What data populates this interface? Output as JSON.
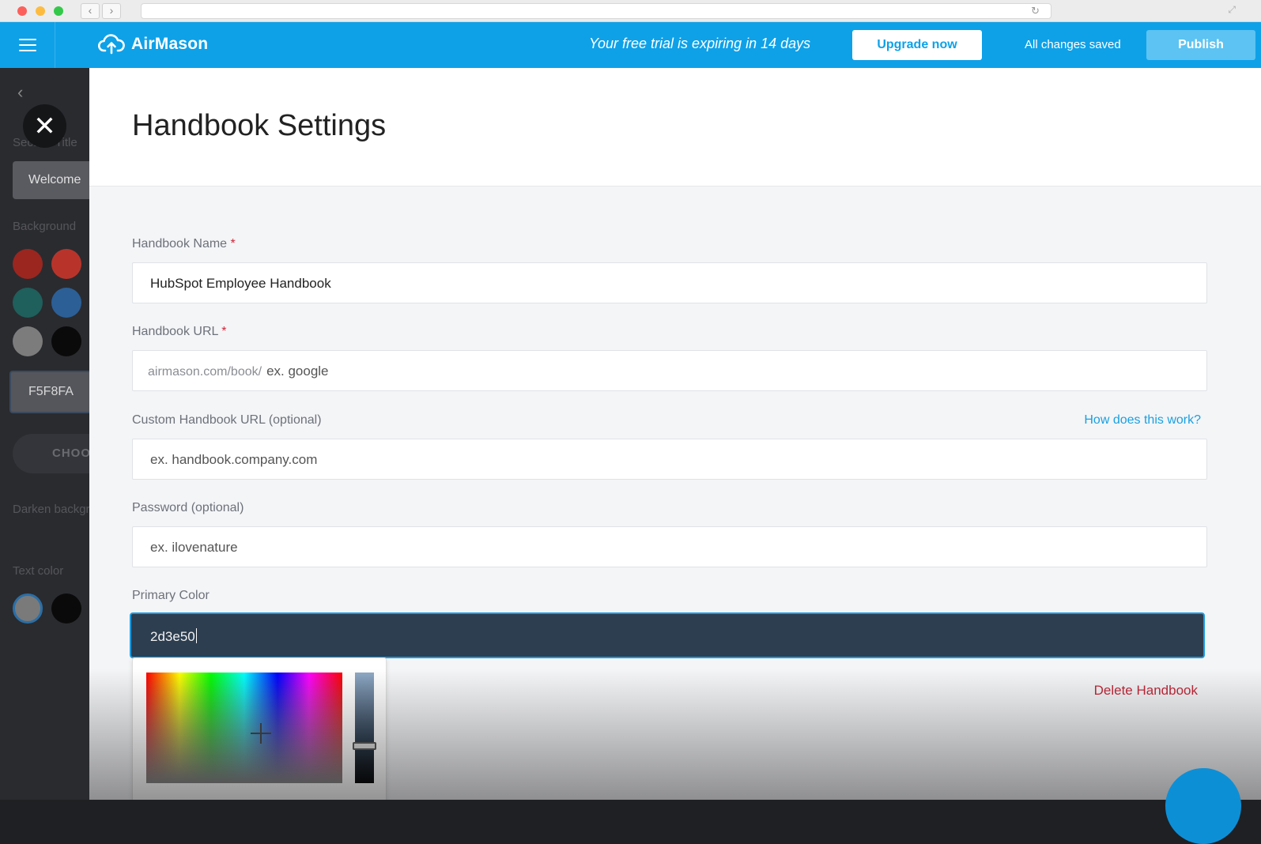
{
  "app": {
    "brand_name": "AirMason",
    "trial_message": "Your free trial is expiring in 14 days",
    "upgrade_label": "Upgrade now",
    "save_status": "All changes saved",
    "publish_label": "Publish",
    "brand_color": "#0ea1e8"
  },
  "sidebar": {
    "section_title_label": "Section Title",
    "section_title_value": "Welcome",
    "background_label": "Background",
    "swatches": [
      "#9b2620",
      "#b8342b",
      "#1f5f5c",
      "#2c5f95",
      "#7c7c7c",
      "#0a0a0a"
    ],
    "hex_value": "F5F8FA",
    "choose_label": "CHOOSE",
    "darken_label": "Darken background",
    "text_color_label": "Text color",
    "text_swatches": [
      "#7a7a7a",
      "#0a0a0a"
    ]
  },
  "modal": {
    "title": "Handbook Settings",
    "fields": {
      "name": {
        "label": "Handbook Name",
        "required": "*",
        "value": "HubSpot Employee Handbook"
      },
      "url": {
        "label": "Handbook URL",
        "required": "*",
        "prefix": "airmason.com/book/",
        "placeholder": "ex. google"
      },
      "custom_url": {
        "label": "Custom Handbook URL (optional)",
        "placeholder": "ex. handbook.company.com",
        "help_link": "How does this work?"
      },
      "password": {
        "label": "Password (optional)",
        "placeholder": "ex. ilovenature"
      },
      "primary_color": {
        "label": "Primary Color",
        "value": "2d3e50"
      }
    },
    "delete_label": "Delete Handbook"
  }
}
